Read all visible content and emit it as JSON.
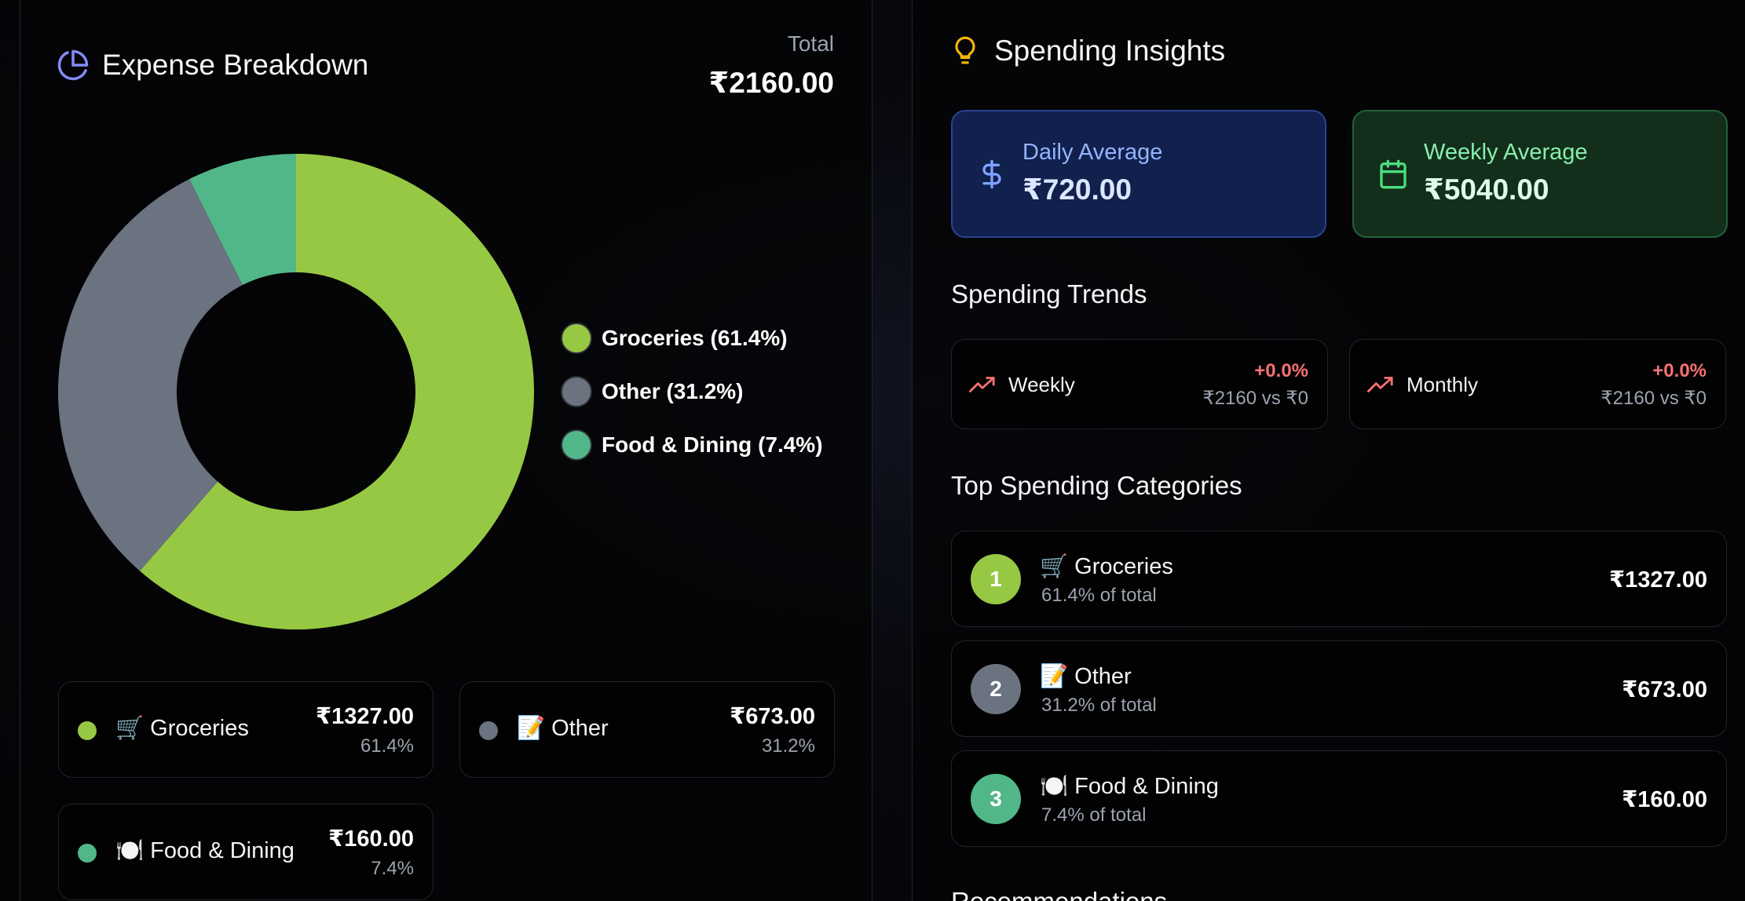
{
  "breakdown": {
    "title": "Expense Breakdown",
    "total_label": "Total",
    "total_value": "₹2160.00",
    "legend": [
      {
        "label": "Groceries (61.4%)",
        "color": "#97c844"
      },
      {
        "label": "Other (31.2%)",
        "color": "#6b7280"
      },
      {
        "label": "Food & Dining (7.4%)",
        "color": "#52b788"
      }
    ],
    "tiles": [
      {
        "name": "🛒 Groceries",
        "amount": "₹1327.00",
        "percent": "61.4%",
        "color": "#97c844"
      },
      {
        "name": "📝 Other",
        "amount": "₹673.00",
        "percent": "31.2%",
        "color": "#6b7280"
      },
      {
        "name": "🍽️ Food & Dining",
        "amount": "₹160.00",
        "percent": "7.4%",
        "color": "#52b788"
      }
    ]
  },
  "chart_data": {
    "type": "pie",
    "categories": [
      "Groceries",
      "Other",
      "Food & Dining"
    ],
    "values": [
      61.4,
      31.2,
      7.4
    ],
    "colors": [
      "#97c844",
      "#6b7280",
      "#52b788"
    ],
    "donut": true,
    "legend_position": "right"
  },
  "insights": {
    "title": "Spending Insights",
    "daily": {
      "label": "Daily Average",
      "value": "₹720.00"
    },
    "weekly": {
      "label": "Weekly Average",
      "value": "₹5040.00"
    },
    "trends_title": "Spending Trends",
    "trends": [
      {
        "label": "Weekly",
        "change": "+0.0%",
        "compare": "₹2160 vs ₹0"
      },
      {
        "label": "Monthly",
        "change": "+0.0%",
        "compare": "₹2160 vs ₹0"
      }
    ],
    "top_title": "Top Spending Categories",
    "top": [
      {
        "rank": "1",
        "name": "🛒 Groceries",
        "sub": "61.4% of total",
        "amount": "₹1327.00",
        "color": "#97c844"
      },
      {
        "rank": "2",
        "name": "📝 Other",
        "sub": "31.2% of total",
        "amount": "₹673.00",
        "color": "#6b7280"
      },
      {
        "rank": "3",
        "name": "🍽️ Food & Dining",
        "sub": "7.4% of total",
        "amount": "₹160.00",
        "color": "#52b788"
      }
    ],
    "recommendations_title": "Recommendations"
  }
}
